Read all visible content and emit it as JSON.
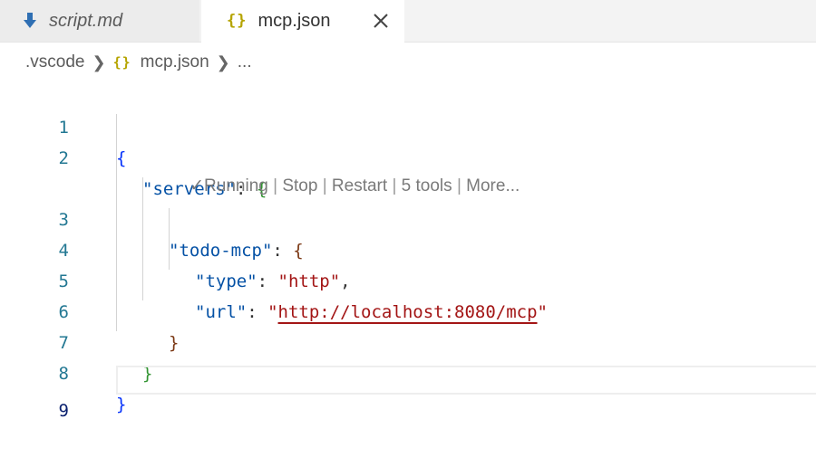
{
  "tabs": [
    {
      "label": "script.md",
      "icon": "arrow-down-icon",
      "active": false
    },
    {
      "label": "mcp.json",
      "icon": "json-braces-icon",
      "active": true
    }
  ],
  "breadcrumb": {
    "folder": ".vscode",
    "file": "mcp.json",
    "more": "..."
  },
  "icons": {
    "braces": "{}"
  },
  "lens": {
    "status": "Running",
    "stop": "Stop",
    "restart": "Restart",
    "tools": "5 tools",
    "more": "More...",
    "separator": "|"
  },
  "editor": {
    "line_numbers": [
      "1",
      "2",
      "3",
      "4",
      "5",
      "6",
      "7",
      "8",
      "9"
    ],
    "lines": {
      "l1_open": "{",
      "l2_key": "\"servers\"",
      "l2_colon": ": ",
      "l2_open": "{",
      "l3_key": "\"todo-mcp\"",
      "l3_colon": ": ",
      "l3_open": "{",
      "l4_key": "\"type\"",
      "l4_colon": ": ",
      "l4_value": "\"http\"",
      "l4_comma": ",",
      "l5_key": "\"url\"",
      "l5_colon": ": ",
      "l5_q1": "\"",
      "l5_value": "http://localhost:8080/mcp",
      "l5_q2": "\"",
      "l6_close": "}",
      "l7_close": "}",
      "l8_close": "}"
    }
  },
  "colors": {
    "line_number": "#237893",
    "brace_level_1": "#0431fa",
    "brace_level_2": "#319331",
    "brace_level_3": "#7b3814",
    "json_key": "#0451a5",
    "json_string": "#a31515"
  }
}
